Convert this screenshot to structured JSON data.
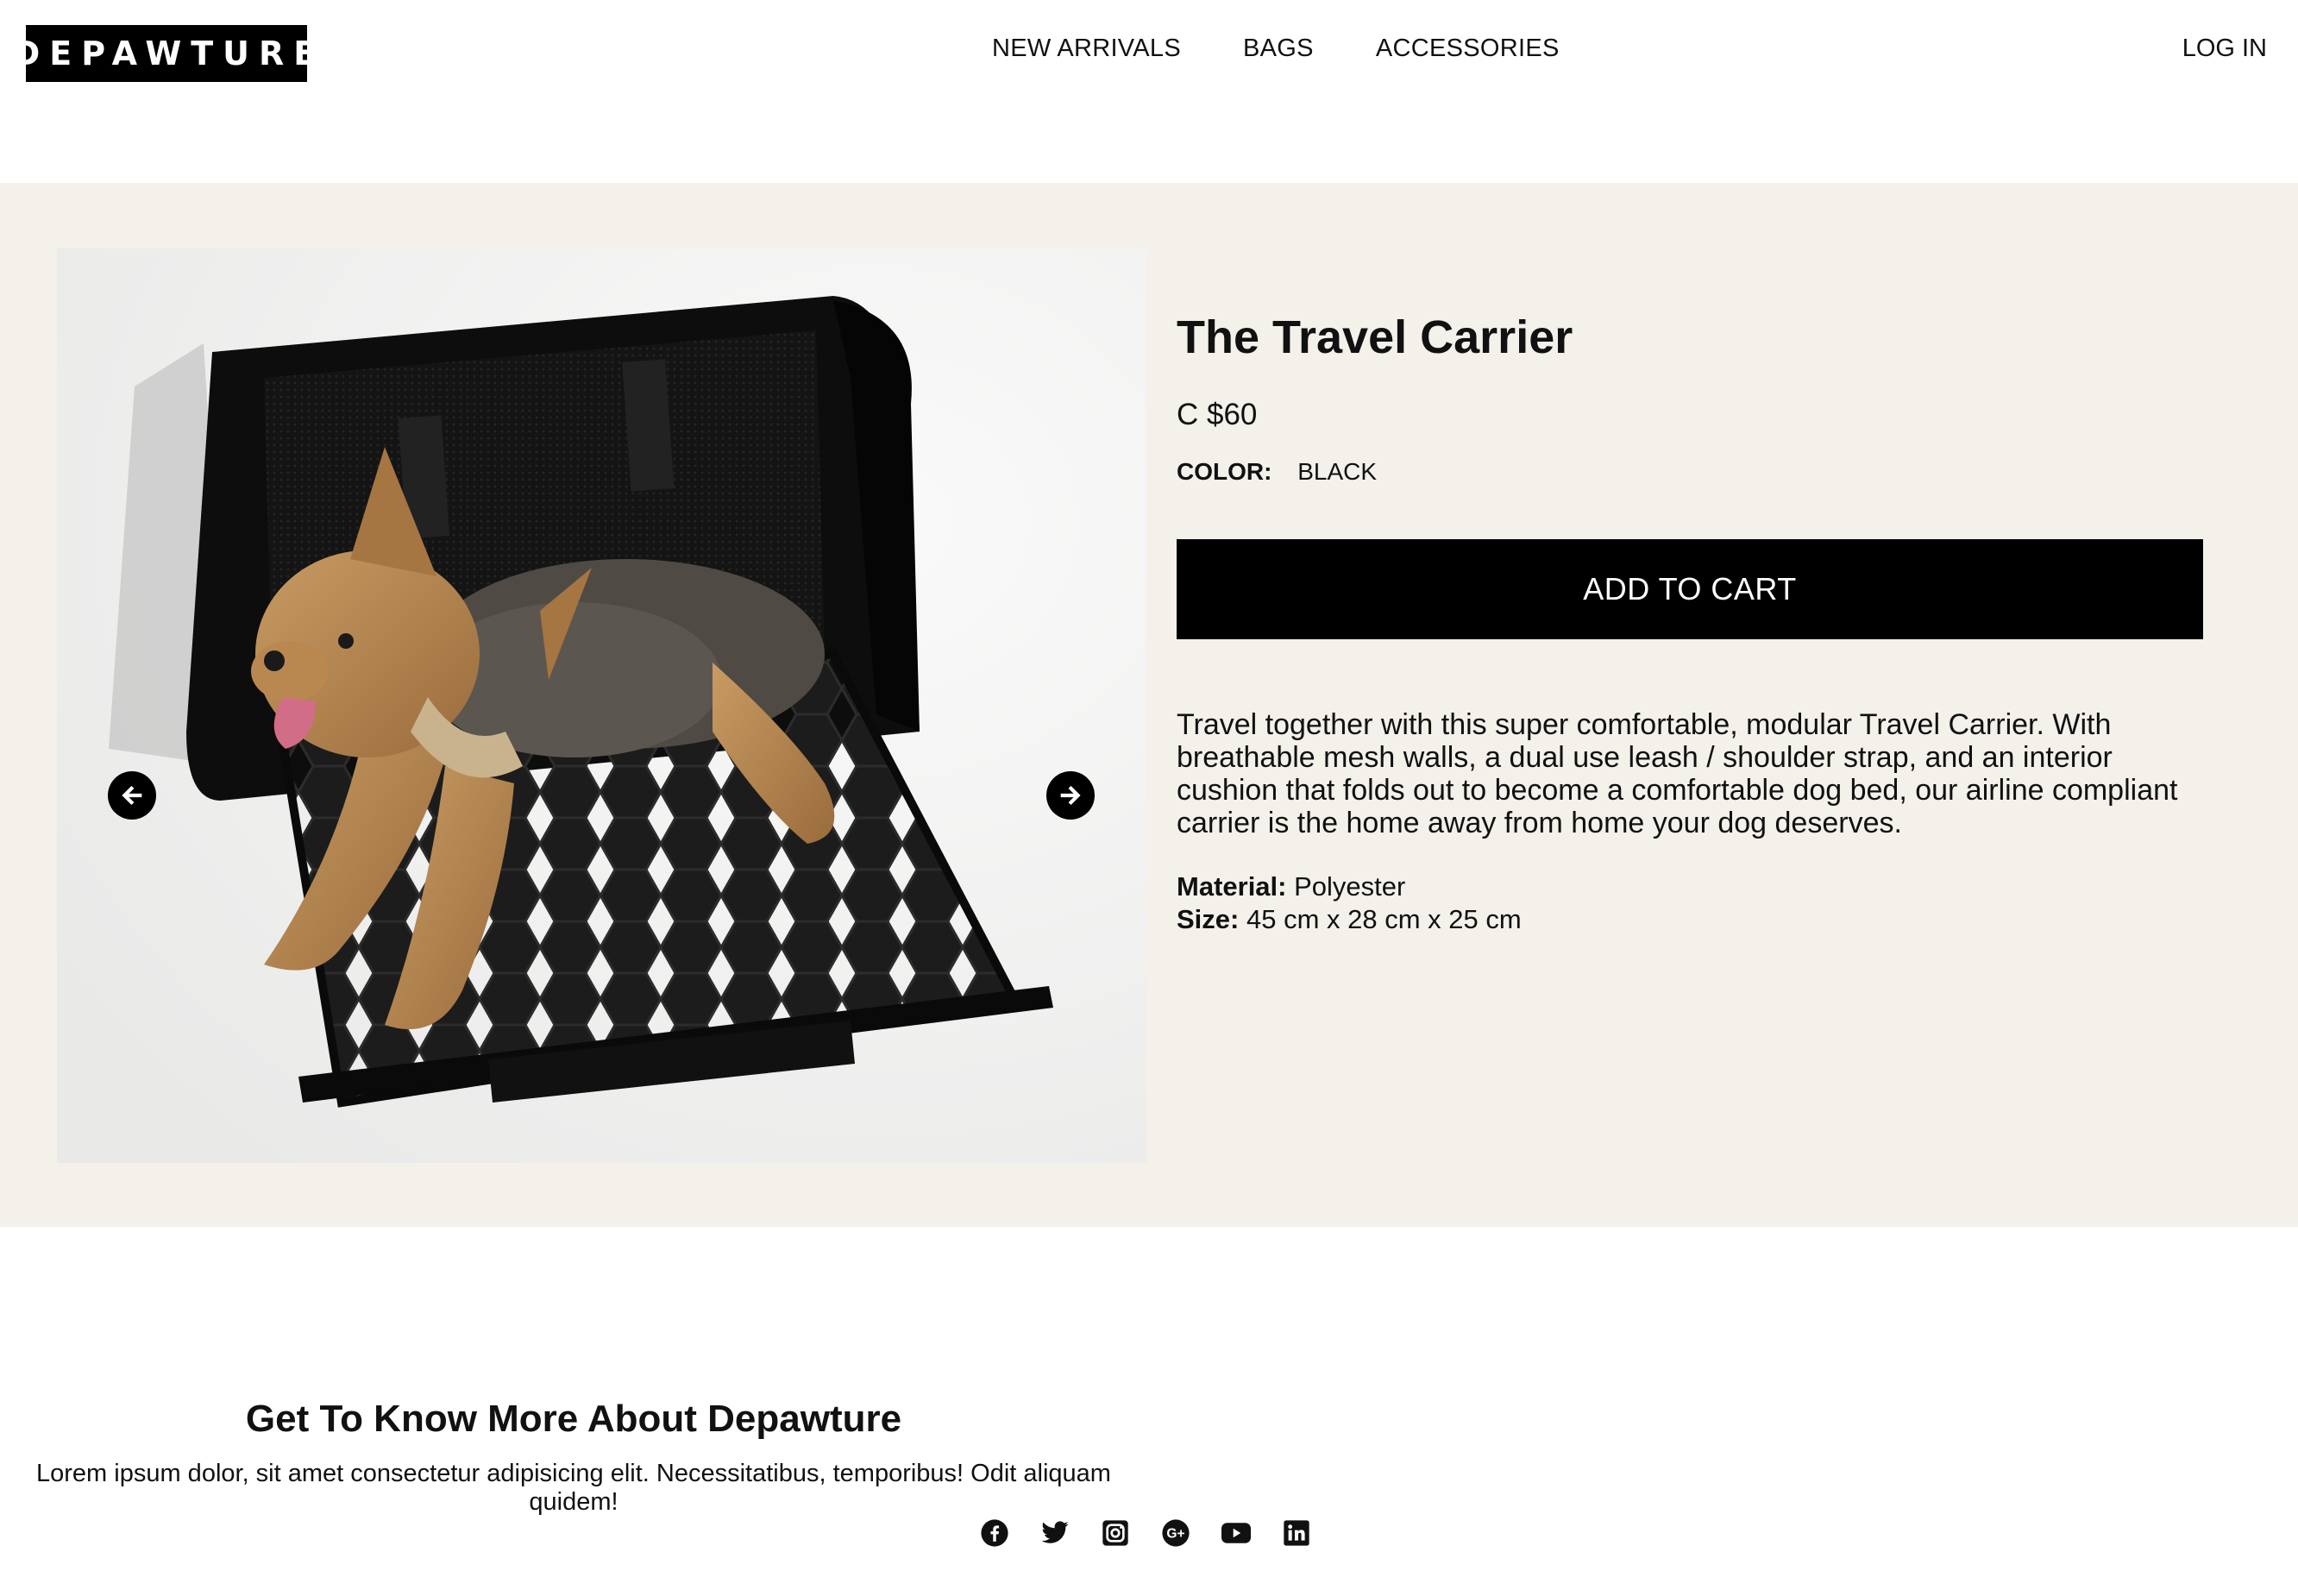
{
  "header": {
    "logo": "DEPAWTURE",
    "nav": [
      "NEW ARRIVALS",
      "BAGS",
      "ACCESSORIES"
    ],
    "login": "LOG IN"
  },
  "product": {
    "title": "The Travel Carrier",
    "price": "C $60",
    "color_label": "COLOR:",
    "color_value": "BLACK",
    "cart_button": "ADD TO CART",
    "description": "Travel together with this super comfortable, modular Travel Carrier. With breathable mesh walls, a dual use leash / shoulder strap, and an interior cushion that folds out to become a comfortable dog bed, our airline compliant carrier is the home away from home your dog deserves.",
    "material_label": "Material:",
    "material_value": "Polyester",
    "size_label": "Size:",
    "size_value": "45 cm x 28 cm x 25 cm"
  },
  "about": {
    "title": "Get To Know More About Depawture",
    "text": "Lorem ipsum dolor, sit amet consectetur adipisicing elit. Necessitatibus, temporibus! Odit aliquam quidem!"
  },
  "socials": [
    "facebook-icon",
    "twitter-icon",
    "instagram-icon",
    "google-plus-icon",
    "youtube-icon",
    "linkedin-icon"
  ],
  "colors": {
    "product_bg": "#f4f0ea",
    "button_bg": "#000000",
    "text": "#111111"
  }
}
